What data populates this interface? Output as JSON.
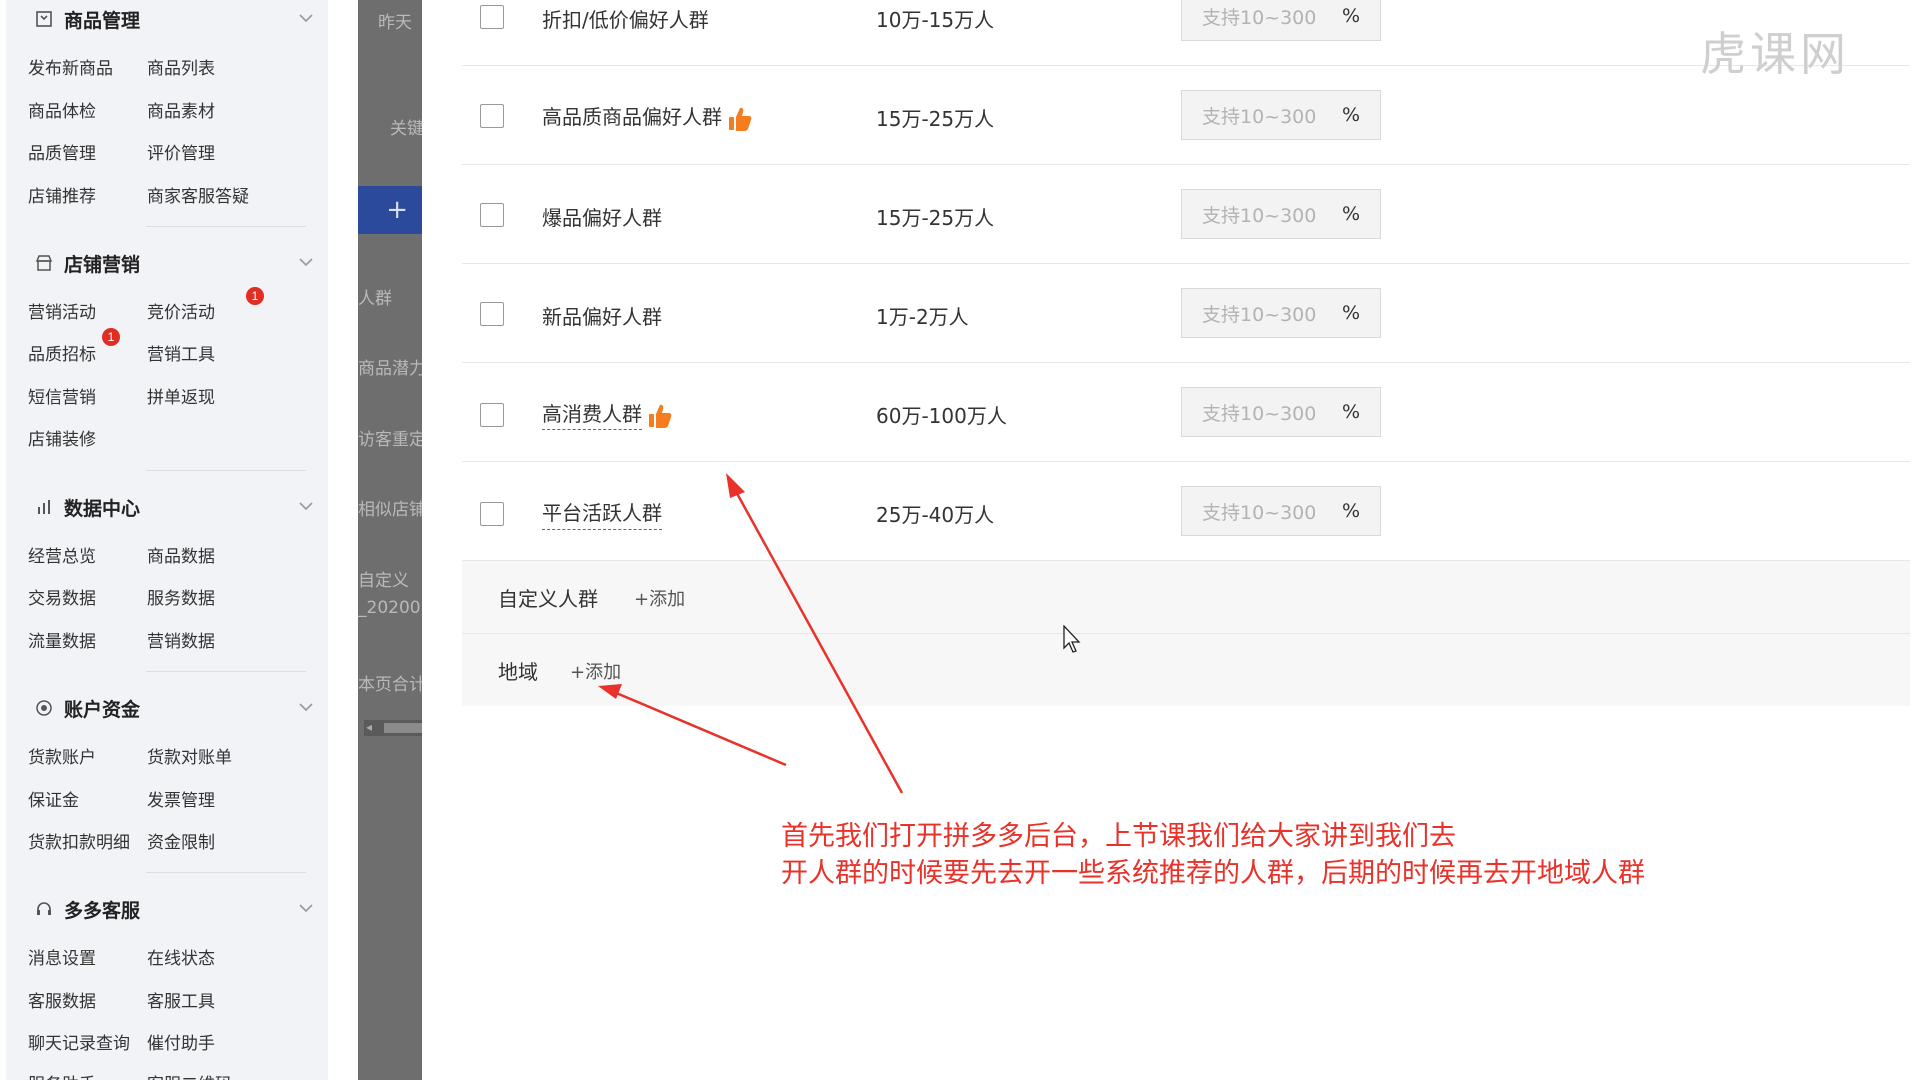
{
  "sidebar": {
    "sections": [
      {
        "title": "商品管理",
        "items": [
          "发布新商品",
          "商品列表",
          "商品体检",
          "商品素材",
          "品质管理",
          "评价管理",
          "店铺推荐",
          "商家客服答疑"
        ]
      },
      {
        "title": "店铺营销",
        "items": [
          "营销活动",
          "竞价活动",
          "品质招标",
          "营销工具",
          "短信营销",
          "拼单返现",
          "店铺装修"
        ],
        "badges": [
          "1",
          "1"
        ]
      },
      {
        "title": "数据中心",
        "items": [
          "经营总览",
          "商品数据",
          "交易数据",
          "服务数据",
          "流量数据",
          "营销数据"
        ]
      },
      {
        "title": "账户资金",
        "items": [
          "货款账户",
          "货款对账单",
          "保证金",
          "发票管理",
          "货款扣款明细",
          "资金限制"
        ]
      },
      {
        "title": "多多客服",
        "items": [
          "消息设置",
          "在线状态",
          "客服数据",
          "客服工具",
          "聊天记录查询",
          "催付助手",
          "服务助手",
          "客服二维码"
        ]
      }
    ]
  },
  "behind": {
    "texts": [
      "昨天",
      "关键",
      "人群",
      "商品潜力",
      "访客重定",
      "相似店铺",
      "自定义",
      "_20200",
      "本页合计"
    ],
    "plus": "+"
  },
  "audience": {
    "rows": [
      {
        "name": "折扣/低价偏好人群",
        "size": "10万-15万人",
        "placeholder": "支持10~300",
        "unit": "%",
        "recommended": false,
        "dotted": false
      },
      {
        "name": "高品质商品偏好人群",
        "size": "15万-25万人",
        "placeholder": "支持10~300",
        "unit": "%",
        "recommended": true,
        "dotted": false
      },
      {
        "name": "爆品偏好人群",
        "size": "15万-25万人",
        "placeholder": "支持10~300",
        "unit": "%",
        "recommended": false,
        "dotted": false
      },
      {
        "name": "新品偏好人群",
        "size": "1万-2万人",
        "placeholder": "支持10~300",
        "unit": "%",
        "recommended": false,
        "dotted": false
      },
      {
        "name": "高消费人群",
        "size": "60万-100万人",
        "placeholder": "支持10~300",
        "unit": "%",
        "recommended": true,
        "dotted": true
      },
      {
        "name": "平台活跃人群",
        "size": "25万-40万人",
        "placeholder": "支持10~300",
        "unit": "%",
        "recommended": false,
        "dotted": true
      }
    ],
    "custom": {
      "label": "自定义人群",
      "add": "+添加"
    },
    "region": {
      "label": "地域",
      "add": "+添加"
    }
  },
  "annotation": {
    "line1": "首先我们打开拼多多后台，上节课我们给大家讲到我们去",
    "line2": "开人群的时候要先去开一些系统推荐的人群，后期的时候再去开地域人群"
  },
  "watermark": "虎课网",
  "colors": {
    "annotation": "#e8322a",
    "badge": "#e02e24",
    "thumb": "#f57c1f"
  }
}
